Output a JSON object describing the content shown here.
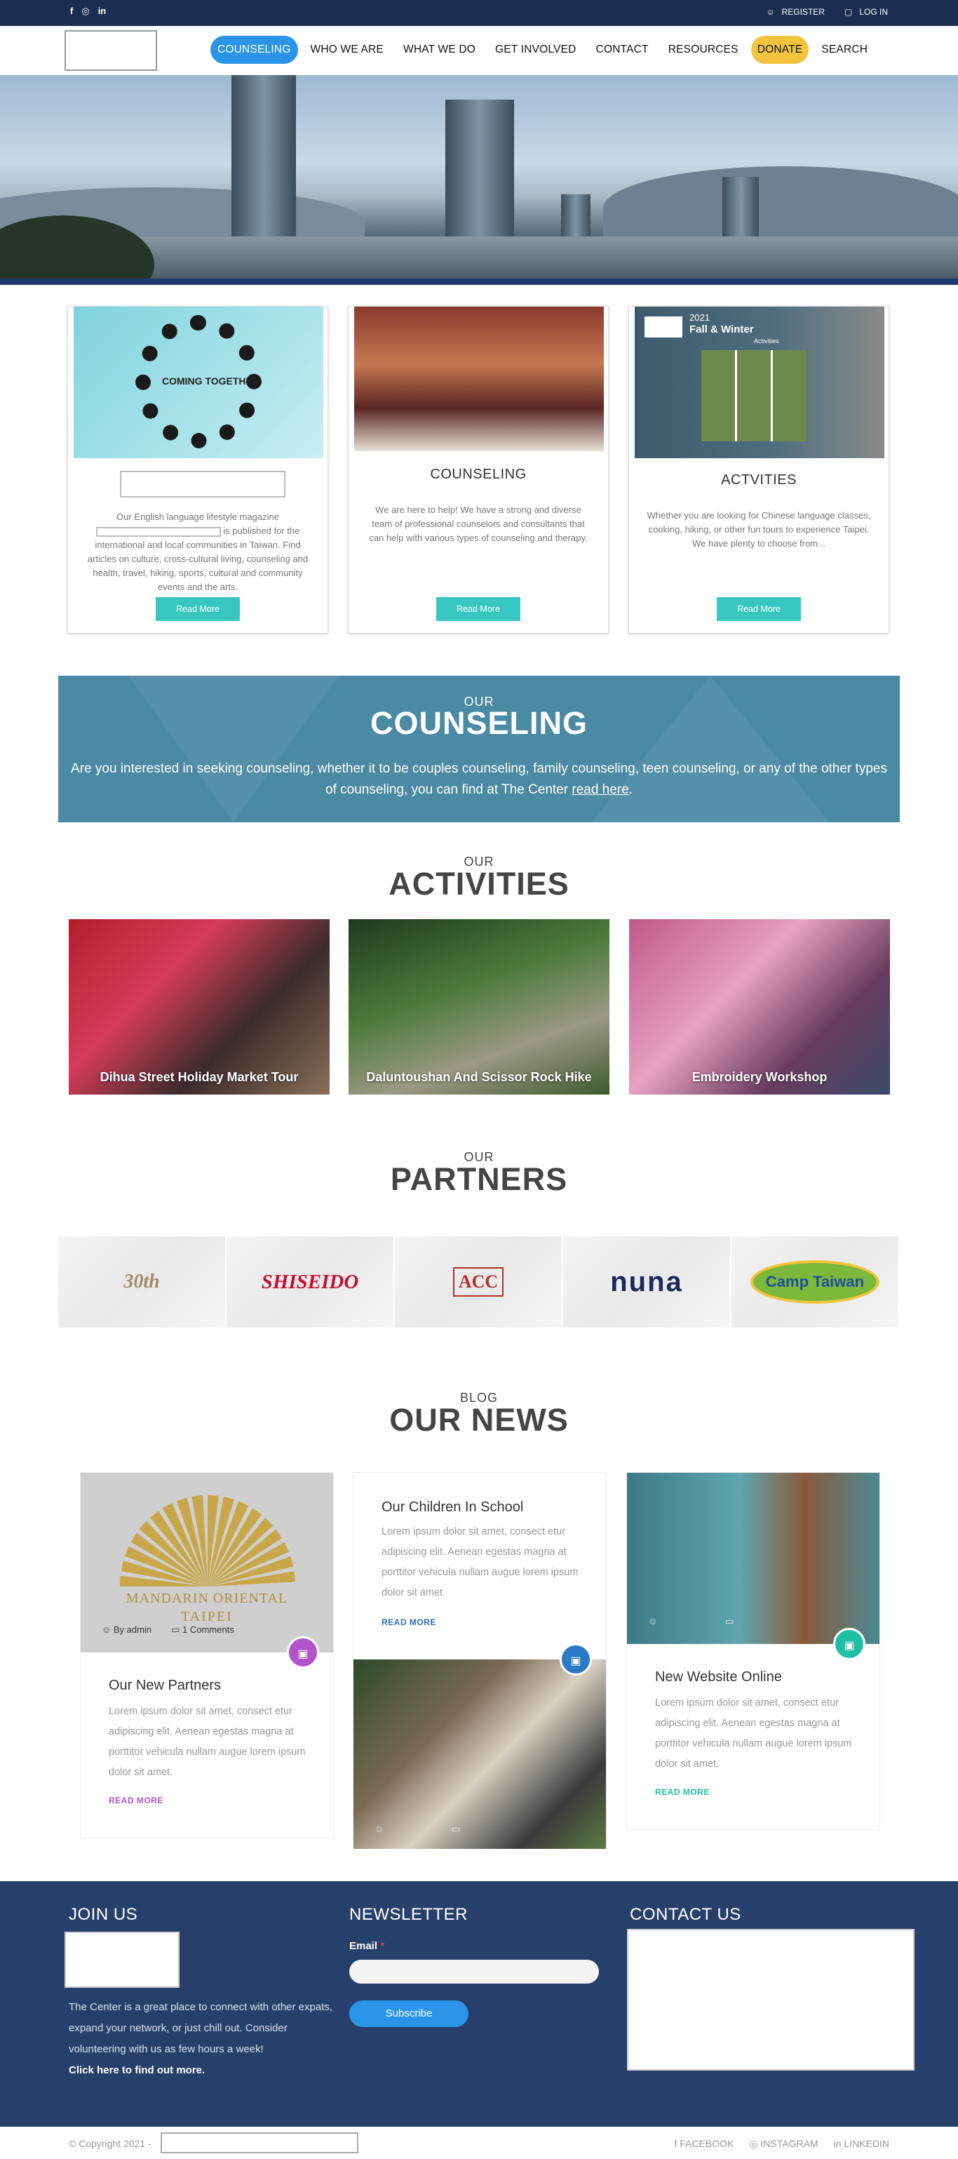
{
  "topbar": {
    "social": [
      "f",
      "◎",
      "in"
    ],
    "register": "REGISTER",
    "login": "LOG IN"
  },
  "nav": {
    "items": [
      "COUNSELING",
      "WHO WE ARE",
      "WHAT WE DO",
      "GET INVOLVED",
      "CONTACT",
      "RESOURCES",
      "DONATE",
      "SEARCH"
    ],
    "active": "COUNSELING"
  },
  "cards": [
    {
      "img_text": "COMING TOGETHER",
      "desc_a": "Our English language lifestyle magazine",
      "desc_b": "is published for the international and local communities in Taiwan. Find articles on culture, cross-cultural living, counseling and health, travel, hiking, sports, cultural and community events and the arts.",
      "button": "Read More"
    },
    {
      "title": "COUNSELING",
      "desc": "We are here to help! We have a strong and diverse team of professional counselors and consultants that can help with various types of counseling and therapy.",
      "button": "Read More"
    },
    {
      "img_year": "2021",
      "img_title": "Fall & Winter",
      "img_sub": "Activities",
      "title": "ACTVITIES",
      "desc": "Whether you are looking for Chinese language classes, cooking, hiking, or other fun tours to experience Taipei. We have plenty to choose from...",
      "button": "Read More"
    }
  ],
  "counseling": {
    "small": "OUR",
    "big": "COUNSELING",
    "text": "Are you interested in seeking counseling, whether it to be couples counseling, family counseling, teen counseling, or any of the other types of counseling, you can find at The Center",
    "link": "read here",
    "end": "."
  },
  "activities": {
    "small": "OUR",
    "big": "ACTIVITIES",
    "items": [
      "Dihua Street Holiday Market Tour",
      "Daluntoushan And Scissor Rock Hike",
      "Embroidery Workshop"
    ]
  },
  "partners": {
    "small": "OUR",
    "big": "PARTNERS",
    "logos": [
      {
        "name": "30th Anniversary Celebration The Sherwood Taipei",
        "display": "30th"
      },
      {
        "name": "SHISEIDO",
        "display": "SHISEIDO"
      },
      {
        "name": "AMERICAN CLUB",
        "display": "ACC"
      },
      {
        "name": "nuna",
        "display": "nuna"
      },
      {
        "name": "Camp Taiwan",
        "display": "Camp Taiwan"
      }
    ]
  },
  "news": {
    "small": "BLOG",
    "big": "OUR NEWS",
    "posts": [
      {
        "img_text": "MANDARIN ORIENTAL",
        "img_sub": "TAIPEI",
        "author": "By admin",
        "comments": "1 Comments",
        "title": "Our New Partners",
        "text": "Lorem ipsum dolor sit amet, consect etur adipiscing elit. Aenean egestas magna at porttitor vehicula nullam augue lorem ipsum dolor sit amet.",
        "more": "READ MORE"
      },
      {
        "title": "Our Children In School",
        "text": "Lorem ipsum dolor sit amet, consect etur adipiscing elit. Aenean egestas magna at porttitor vehicula nullam augue lorem ipsum dolor sit amet.",
        "more": "READ MORE"
      },
      {
        "title": "New Website Online",
        "text": "Lorem ipsum dolor sit amet, consect etur adipiscing elit. Aenean egestas magna at porttitor vehicula nullam augue lorem ipsum dolor sit amet.",
        "more": "READ MORE"
      }
    ]
  },
  "footer": {
    "join_title": "JOIN US",
    "about": "The Center is a great place to connect with other expats, expand your network, or just chill out. Consider volunteering with us as few hours a week!",
    "about_link": "Click here to find out more.",
    "newsletter_title": "NEWSLETTER",
    "email_label": "Email",
    "required": "*",
    "subscribe": "Subscribe",
    "contact_title": "CONTACT US"
  },
  "bottom": {
    "copyright": "© Copyright 2021 -",
    "links": [
      "FACEBOOK",
      "INSTAGRAM",
      "LINKEDIN"
    ]
  },
  "colors": {
    "topbar": "#1b2e52",
    "accent_blue": "#2a95e8",
    "donate_yellow": "#f2c43d",
    "teal_button": "#38c7c0",
    "banner": "#4a8aa3",
    "footer": "#27406b",
    "purple": "#b154c9"
  }
}
